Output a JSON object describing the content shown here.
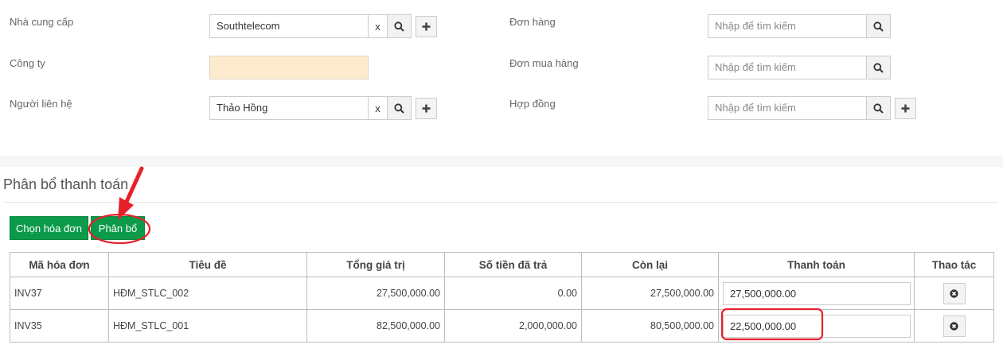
{
  "form": {
    "supplier": {
      "label": "Nhà cung cấp",
      "value": "Southtelecom",
      "clear": "x"
    },
    "company": {
      "label": "Công ty",
      "value": ""
    },
    "contact": {
      "label": "Người liên hệ",
      "value": "Thảo Hồng",
      "clear": "x"
    },
    "order": {
      "label": "Đơn hàng",
      "placeholder": "Nhập để tìm kiếm"
    },
    "purchase_order": {
      "label": "Đơn mua hàng",
      "placeholder": "Nhập để tìm kiếm"
    },
    "contract": {
      "label": "Hợp đồng",
      "placeholder": "Nhập để tìm kiếm"
    }
  },
  "allocation": {
    "title": "Phân bổ thanh toán",
    "choose_invoice_label": "Chọn hóa đơn",
    "allocate_label": "Phân bổ"
  },
  "table": {
    "headers": [
      "Mã hóa đơn",
      "Tiêu đề",
      "Tổng giá trị",
      "Số tiền đã trả",
      "Còn lại",
      "Thanh toán",
      "Thao tác"
    ],
    "rows": [
      {
        "code": "INV37",
        "title": "HĐM_STLC_002",
        "total": "27,500,000.00",
        "paid": "0.00",
        "remaining": "27,500,000.00",
        "payment": "27,500,000.00"
      },
      {
        "code": "INV35",
        "title": "HĐM_STLC_001",
        "total": "82,500,000.00",
        "paid": "2,000,000.00",
        "remaining": "80,500,000.00",
        "payment": "22,500,000.00"
      }
    ]
  },
  "colors": {
    "primary_green": "#0b9a4a",
    "annotation_red": "#e8202a",
    "peach_field": "#fdebd0"
  },
  "icons": {
    "search": "search-icon",
    "plus": "plus-icon",
    "delete": "times-circle-icon"
  }
}
